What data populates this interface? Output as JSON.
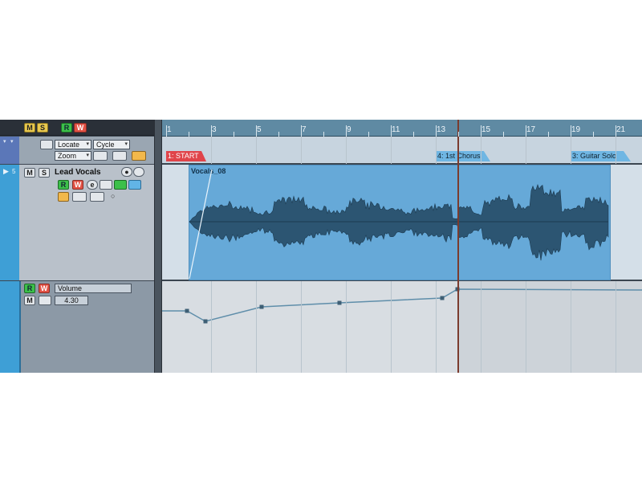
{
  "global": {
    "mute_solo_buttons": [
      "M",
      "S"
    ],
    "read_write_buttons": [
      "R",
      "W"
    ]
  },
  "marker_track": {
    "locate_label": "Locate",
    "cycle_label": "Cycle",
    "zoom_label": "Zoom"
  },
  "audio_track": {
    "number": "5",
    "name": "Lead Vocals",
    "mute": "M",
    "solo": "S",
    "read": "R",
    "write": "W",
    "edit": "e"
  },
  "automation_track": {
    "read": "R",
    "write": "W",
    "parameter": "Volume",
    "value": "4.30",
    "mute": "M"
  },
  "ruler": {
    "bars": [
      "1",
      "3",
      "5",
      "7",
      "9",
      "11",
      "13",
      "15",
      "17",
      "19",
      "21"
    ]
  },
  "markers": [
    {
      "label": "1: START",
      "color": "#e0444a"
    },
    {
      "label": "4: 1st Chorus",
      "color": "#6fb6e3"
    },
    {
      "label": "3: Guitar Solo",
      "color": "#6fb6e3"
    }
  ],
  "event": {
    "name": "Vocals_08",
    "color": "#66a9d8"
  },
  "colors": {
    "track_strip": "#3e9fd6",
    "playhead": "#7b3b2e",
    "ruler": "#5f8aa3"
  }
}
